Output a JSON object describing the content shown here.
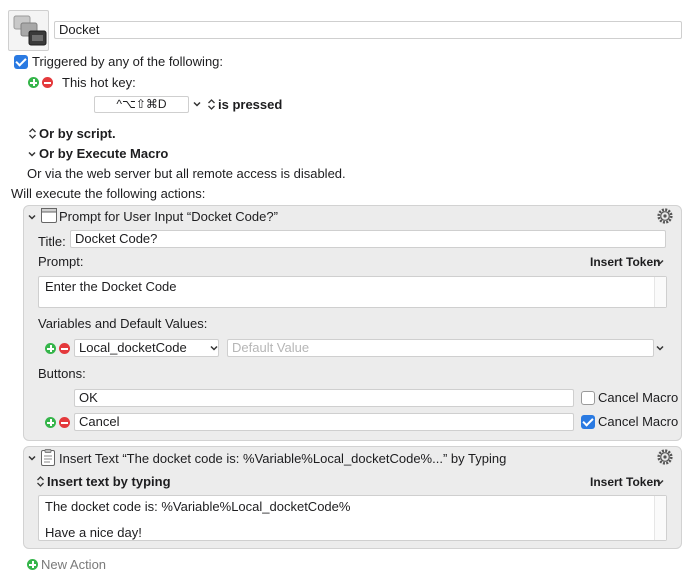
{
  "macro": {
    "name": "Docket"
  },
  "trigger": {
    "header": "Triggered by any of the following:",
    "hotkey_label": "This hot key:",
    "hotkey_value": "^⌥⇧⌘D",
    "hotkey_condition": "is pressed",
    "by_script": "Or by script.",
    "by_execute_macro": "Or by Execute Macro",
    "web_server_note": "Or via the web server but all remote access is disabled."
  },
  "actions_header": "Will execute the following actions:",
  "prompt_action": {
    "title": "Prompt for User Input “Docket Code?”",
    "title_label": "Title:",
    "title_value": "Docket Code?",
    "prompt_label": "Prompt:",
    "insert_token": "Insert Token",
    "prompt_text": "Enter the Docket Code",
    "variables_label": "Variables and Default Values:",
    "variable_name": "Local_docketCode",
    "default_placeholder": "Default Value",
    "buttons_label": "Buttons:",
    "buttons": [
      {
        "label": "OK",
        "cancel_label": "Cancel Macro",
        "cancel_checked": false
      },
      {
        "label": "Cancel",
        "cancel_label": "Cancel Macro",
        "cancel_checked": true
      }
    ]
  },
  "insert_action": {
    "title": "Insert Text “The docket code is: %Variable%Local_docketCode%...” by Typing",
    "mode": "Insert text by typing",
    "insert_token": "Insert Token",
    "text_line1": "The docket code is: %Variable%Local_docketCode%",
    "text_line2": "Have a nice day!"
  },
  "new_action": "New Action",
  "colors": {
    "accent": "#2a7ae2",
    "add": "#35b54a",
    "remove": "#e4393c"
  },
  "icons": [
    "macro-icon",
    "window-icon",
    "clipboard-icon",
    "gear-icon",
    "chevron-down-icon",
    "up-down-arrows-icon"
  ]
}
